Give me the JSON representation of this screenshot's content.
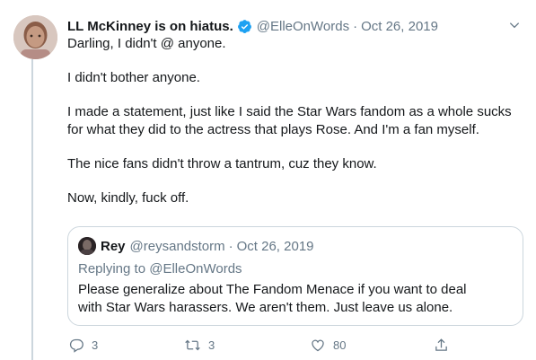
{
  "tweet": {
    "display_name": "LL McKinney is on hiatus.",
    "handle": "@ElleOnWords",
    "separator": "·",
    "date": "Oct 26, 2019",
    "paragraphs": [
      "Darling, I didn't @ anyone.",
      "I didn't bother anyone.",
      "I made a statement, just like I said the Star Wars fandom as a whole sucks for what they did to the actress that plays Rose. And I'm a fan myself.",
      "The nice fans didn't throw a tantrum, cuz they know.",
      "Now, kindly, fuck off."
    ],
    "icons": {
      "verified": "verified-badge-icon",
      "menu": "chevron-down-icon"
    }
  },
  "quoted_tweet": {
    "display_name": "Rey",
    "handle": "@reysandstorm",
    "separator": "·",
    "date": "Oct 26, 2019",
    "replying_prefix": "Replying to",
    "replying_to": "@ElleOnWords",
    "text": "Please generalize about The Fandom Menace if you want to deal with Star Wars harassers. We aren't them. Just leave us alone."
  },
  "actions": {
    "reply_count": "3",
    "retweet_count": "3",
    "like_count": "80",
    "icons": [
      "reply-icon",
      "retweet-icon",
      "like-icon",
      "share-icon"
    ]
  },
  "colors": {
    "verified_blue": "#1da1f2",
    "secondary_text": "#657786",
    "border": "#ccd6dd"
  }
}
